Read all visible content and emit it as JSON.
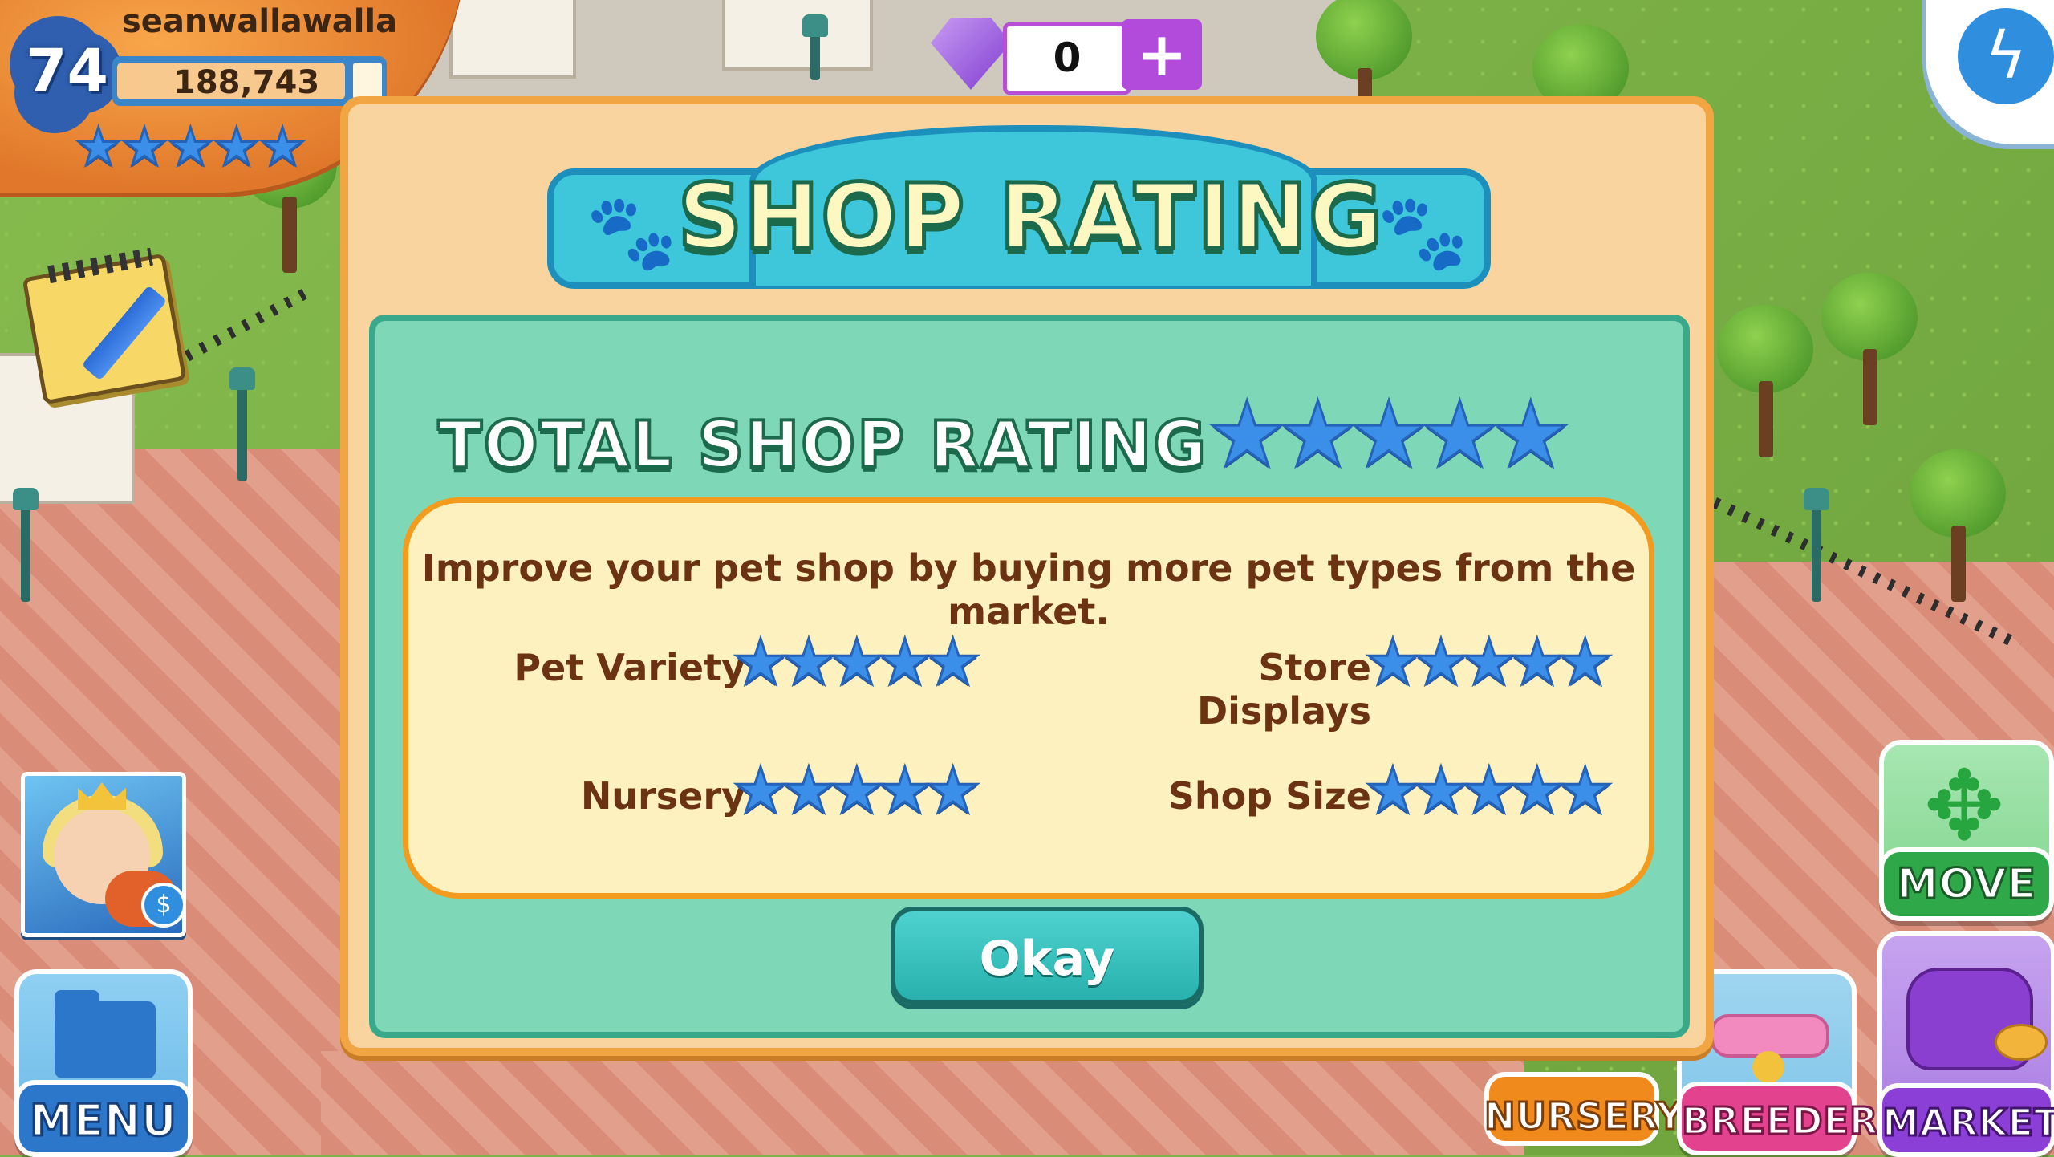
{
  "player": {
    "level": "74",
    "name": "seanwallawalla",
    "coins": "188,743",
    "rating_stars": 5
  },
  "gems": {
    "value": "0",
    "add_label": "+"
  },
  "dialog": {
    "title": "SHOP RATING",
    "total_label": "TOTAL SHOP RATING",
    "total_stars": 5,
    "info_text": "Improve your pet shop by buying more pet types from the market.",
    "categories": [
      {
        "label": "Pet Variety",
        "stars": 5
      },
      {
        "label": "Store Displays",
        "stars": 5
      },
      {
        "label": "Nursery",
        "stars": 5
      },
      {
        "label": "Shop Size",
        "stars": 5
      }
    ],
    "okay_label": "Okay"
  },
  "buttons": {
    "menu": "MENU",
    "move": "MOVE",
    "nursery": "NURSERY",
    "breeder": "BREEDER",
    "market": "MARKET"
  },
  "icons": {
    "star": "star-icon",
    "paw": "paw-icon",
    "gem": "gem-icon",
    "notepad": "notepad-icon",
    "folder": "folder-icon",
    "move": "move-arrows-icon",
    "collar": "collar-icon",
    "purse": "purse-icon"
  },
  "colors": {
    "dialog_bg": "#fad49e",
    "dialog_border": "#f2a643",
    "panel_bg": "#7ed7b7",
    "banner": "#3ec6da",
    "star_blue": "#3b8fe8",
    "okay": "#27b1ad"
  }
}
